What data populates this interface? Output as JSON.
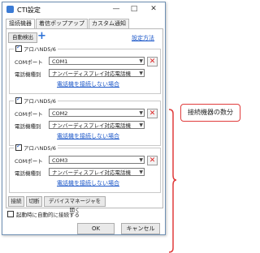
{
  "window": {
    "title": "CTI設定",
    "minimize_glyph": "—",
    "maximize_glyph": "□",
    "close_glyph": "✕"
  },
  "tabs": [
    {
      "label": "接続機器",
      "active": true
    },
    {
      "label": "着信ポップアップ",
      "active": false
    },
    {
      "label": "カスタム通知",
      "active": false
    }
  ],
  "toolbar": {
    "auto_detect_label": "自動検出",
    "add_glyph": "+",
    "settings_link": "設定方法"
  },
  "devices": [
    {
      "name": "アロハND5/6",
      "checked": true,
      "com_label": "COMポート",
      "com_value": "COM1",
      "type_label": "電話機種別",
      "type_value": "ナンバーディスプレイ対応電話機",
      "link": "電話機を接続しない場合"
    },
    {
      "name": "アロハND5/6",
      "checked": true,
      "com_label": "COMポート",
      "com_value": "COM2",
      "type_label": "電話機種別",
      "type_value": "ナンバーディスプレイ対応電話機",
      "link": "電話機を接続しない場合"
    },
    {
      "name": "アロハND5/6",
      "checked": true,
      "com_label": "COMポート",
      "com_value": "COM3",
      "type_label": "電話機種別",
      "type_value": "ナンバーディスプレイ対応電話機",
      "link": "電話機を接続しない場合"
    }
  ],
  "actions": {
    "connect": "接続",
    "disconnect": "切断",
    "device_manager": "デバイスマネージャを開く"
  },
  "auto_connect": {
    "label": "起動時に自動的に接続する",
    "checked": false
  },
  "footer": {
    "ok": "OK",
    "cancel": "キャンセル"
  },
  "annotation": {
    "text": "接続機器の数分",
    "color": "#e03c3c"
  }
}
